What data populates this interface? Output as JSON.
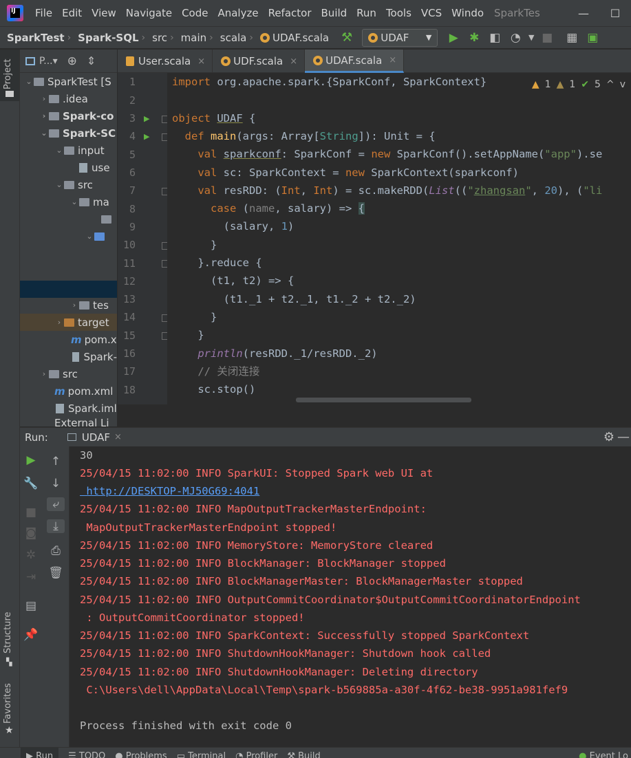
{
  "window": {
    "logo_text": "IJ",
    "title": "SparkTes",
    "menu": [
      "File",
      "Edit",
      "View",
      "Navigate",
      "Code",
      "Analyze",
      "Refactor",
      "Build",
      "Run",
      "Tools",
      "VCS",
      "Windo"
    ],
    "controls": [
      "—",
      "☐"
    ]
  },
  "breadcrumb": [
    "SparkTest",
    "Spark-SQL",
    "src",
    "main",
    "scala",
    "UDAF.scala"
  ],
  "run_config": "UDAF",
  "project_panel": {
    "header": "P...▾",
    "tree": [
      {
        "label": "SparkTest [S",
        "arrow": "⌄"
      },
      {
        "label": ".idea",
        "arrow": "›"
      },
      {
        "label": "Spark-co",
        "arrow": "›"
      },
      {
        "label": "Spark-SC",
        "arrow": "⌄"
      },
      {
        "label": "input",
        "arrow": "⌄"
      },
      {
        "label": "use",
        "arrow": ""
      },
      {
        "label": "src",
        "arrow": "⌄"
      },
      {
        "label": "ma",
        "arrow": "⌄"
      },
      {
        "label": "",
        "arrow": ""
      },
      {
        "label": "",
        "arrow": "⌄"
      },
      {
        "label": "",
        "arrow": ""
      },
      {
        "label": "",
        "arrow": ""
      },
      {
        "label": "tes",
        "arrow": "›"
      },
      {
        "label": "target",
        "arrow": "›"
      },
      {
        "label": "pom.x",
        "arrow": ""
      },
      {
        "label": "Spark-",
        "arrow": ""
      },
      {
        "label": "src",
        "arrow": "›"
      },
      {
        "label": "pom.xml",
        "arrow": ""
      },
      {
        "label": "Spark.iml",
        "arrow": ""
      },
      {
        "label": "External Li",
        "arrow": ""
      }
    ]
  },
  "tabs": [
    {
      "label": "User.scala",
      "close": "×"
    },
    {
      "label": "UDF.scala",
      "close": "×"
    },
    {
      "label": "UDAF.scala",
      "close": "×"
    }
  ],
  "inspections": {
    "warn1": "1",
    "warn2": "1",
    "ok": "5",
    "up": "^",
    "down": "v"
  },
  "editor": {
    "line_numbers": [
      "1",
      "2",
      "3",
      "4",
      "5",
      "6",
      "7",
      "8",
      "9",
      "10",
      "11",
      "12",
      "13",
      "14",
      "15",
      "16",
      "17",
      "18"
    ],
    "lines": [
      "import org.apache.spark.{SparkConf, SparkContext}",
      "",
      "object UDAF {",
      "  def main(args: Array[String]): Unit = {",
      "    val sparkconf: SparkConf = new SparkConf().setAppName(\"app\").se",
      "    val sc: SparkContext = new SparkContext(sparkconf)",
      "    val resRDD: (Int, Int) = sc.makeRDD(List((\"zhangsan\", 20), (\"li",
      "      case (name, salary) => {",
      "        (salary, 1)",
      "      }",
      "    }.reduce {",
      "      (t1, t2) => {",
      "        (t1._1 + t2._1, t1._2 + t2._2)",
      "      }",
      "    }",
      "    println(resRDD._1/resRDD._2)",
      "    // 关闭连接",
      "    sc.stop()"
    ]
  },
  "run_panel": {
    "label": "Run:",
    "tab": "UDAF",
    "tab_close": "×",
    "console": [
      {
        "text": "30",
        "style": "white"
      },
      {
        "text": "25/04/15 11:02:00 INFO SparkUI: Stopped Spark web UI at",
        "style": "red"
      },
      {
        "text": " http://DESKTOP-MJ50G69:4041",
        "style": "link"
      },
      {
        "text": "25/04/15 11:02:00 INFO MapOutputTrackerMasterEndpoint:",
        "style": "red"
      },
      {
        "text": " MapOutputTrackerMasterEndpoint stopped!",
        "style": "red"
      },
      {
        "text": "25/04/15 11:02:00 INFO MemoryStore: MemoryStore cleared",
        "style": "red"
      },
      {
        "text": "25/04/15 11:02:00 INFO BlockManager: BlockManager stopped",
        "style": "red"
      },
      {
        "text": "25/04/15 11:02:00 INFO BlockManagerMaster: BlockManagerMaster stopped",
        "style": "red"
      },
      {
        "text": "25/04/15 11:02:00 INFO OutputCommitCoordinator$OutputCommitCoordinatorEndpoint",
        "style": "red"
      },
      {
        "text": " : OutputCommitCoordinator stopped!",
        "style": "red"
      },
      {
        "text": "25/04/15 11:02:00 INFO SparkContext: Successfully stopped SparkContext",
        "style": "red"
      },
      {
        "text": "25/04/15 11:02:00 INFO ShutdownHookManager: Shutdown hook called",
        "style": "red"
      },
      {
        "text": "25/04/15 11:02:00 INFO ShutdownHookManager: Deleting directory",
        "style": "red"
      },
      {
        "text": " C:\\Users\\dell\\AppData\\Local\\Temp\\spark-b569885a-a30f-4f62-be38-9951a981fef9",
        "style": "red"
      },
      {
        "text": "",
        "style": "white"
      },
      {
        "text": "Process finished with exit code 0",
        "style": "white"
      }
    ]
  },
  "side_tabs": {
    "project": "Project",
    "structure": "Structure",
    "favorites": "Favorites"
  },
  "bottom_tabs": [
    "Run",
    "TODO",
    "Problems",
    "Terminal",
    "Profiler",
    "Build",
    "Event Lo"
  ]
}
